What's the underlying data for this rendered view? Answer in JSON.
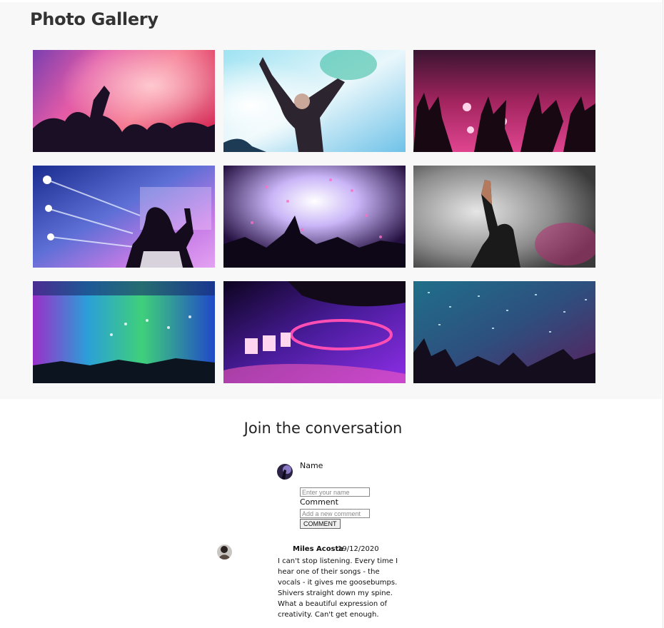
{
  "gallery": {
    "title": "Photo Gallery",
    "photos": [
      {
        "subject": "pink stage haze with raised hands"
      },
      {
        "subject": "dancer with hands up in blue light"
      },
      {
        "subject": "magenta lit raised hands"
      },
      {
        "subject": "woman facing blue laser stage"
      },
      {
        "subject": "confetti explosion over crowd"
      },
      {
        "subject": "man reaching up in smoke"
      },
      {
        "subject": "colorful festival stage lights"
      },
      {
        "subject": "purple DJ turntable controller"
      },
      {
        "subject": "teal confetti over crowd"
      }
    ]
  },
  "conversation": {
    "title": "Join the conversation",
    "form": {
      "name_label": "Name",
      "name_placeholder": "Enter your name",
      "comment_label": "Comment",
      "comment_placeholder": "Add a new comment",
      "submit_label": "COMMENT"
    },
    "comments": [
      {
        "author": "Miles Acosta",
        "date": "19/12/2020",
        "text": "I can't stop listening. Every time I hear one of their songs - the vocals - it gives me goosebumps. Shivers straight down my spine. What a beautiful expression of creativity. Can't get enough."
      }
    ]
  }
}
